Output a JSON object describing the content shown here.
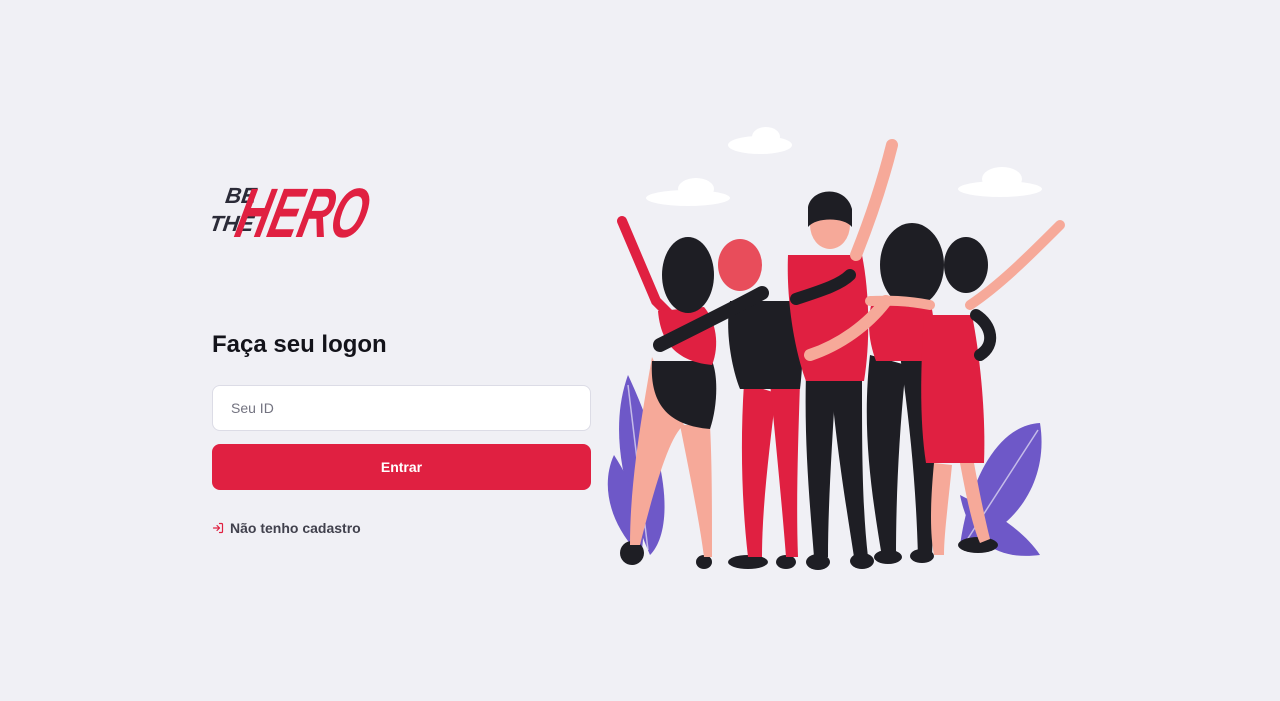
{
  "logo": {
    "text": "BE THE HERO",
    "brand_color": "#e02041",
    "dark_color": "#2b2b38"
  },
  "login": {
    "title": "Faça seu logon",
    "id_placeholder": "Seu ID",
    "id_value": "",
    "submit_label": "Entrar",
    "register_label": "Não tenho cadastro",
    "register_icon": "log-in-icon"
  },
  "illustration": {
    "description_icon": "heroes-group-illustration"
  },
  "colors": {
    "accent": "#e02041",
    "background": "#f0f0f5",
    "text": "#13131a",
    "muted": "#41414d"
  }
}
